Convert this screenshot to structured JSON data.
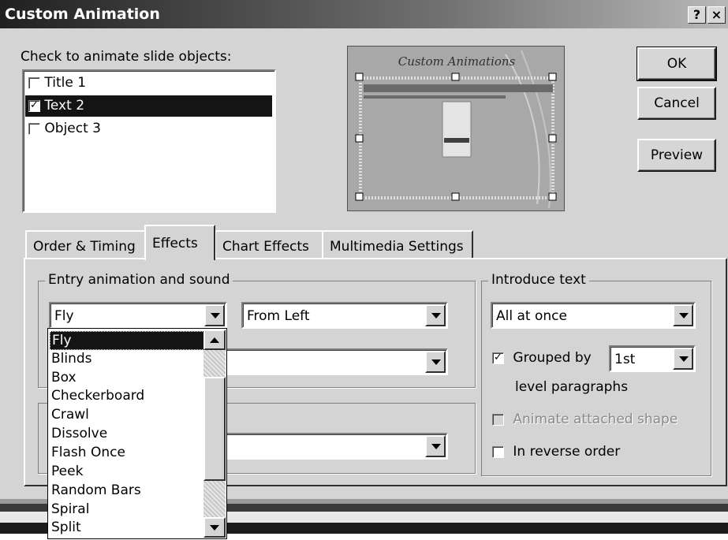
{
  "window": {
    "title": "Custom Animation",
    "help_label": "?",
    "close_label": "×"
  },
  "objects": {
    "label": "Check to animate slide objects:",
    "items": [
      {
        "label": "Title 1",
        "checked": false,
        "selected": false
      },
      {
        "label": "Text 2",
        "checked": true,
        "selected": true
      },
      {
        "label": "Object 3",
        "checked": false,
        "selected": false
      }
    ]
  },
  "preview": {
    "slide_title": "Custom Animations"
  },
  "buttons": {
    "ok": "OK",
    "cancel": "Cancel",
    "preview": "Preview"
  },
  "tabs": [
    {
      "label": "Order & Timing",
      "active": false
    },
    {
      "label": "Effects",
      "active": true
    },
    {
      "label": "Chart Effects",
      "active": false
    },
    {
      "label": "Multimedia Settings",
      "active": false
    }
  ],
  "entry": {
    "group_title": "Entry animation and sound",
    "effect_value": "Fly",
    "direction_value": "From Left",
    "sound_value": "",
    "after_value": ""
  },
  "effect_options": [
    "Fly",
    "Blinds",
    "Box",
    "Checkerboard",
    "Crawl",
    "Dissolve",
    "Flash Once",
    "Peek",
    "Random Bars",
    "Spiral",
    "Split"
  ],
  "introduce": {
    "group_title": "Introduce text",
    "mode_value": "All at once",
    "grouped_label": "Grouped by",
    "grouped_checked": true,
    "grouped_value": "1st",
    "level_label": "level paragraphs",
    "attached_label": "Animate attached shape",
    "attached_checked": false,
    "reverse_label": "In reverse order",
    "reverse_checked": false
  },
  "colors": {
    "selection": "#141414",
    "face": "#d4d4d4",
    "titlebar_start": "#202020"
  }
}
